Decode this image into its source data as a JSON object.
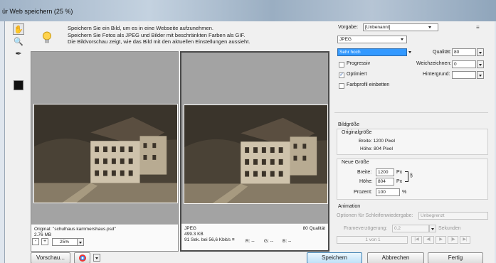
{
  "window": {
    "title": "ür Web speichern (25 %)"
  },
  "info": {
    "line1": "Speichern Sie ein Bild, um es in eine Webseite aufzunehmen.",
    "line2": "Speichern Sie Fotos als JPEG und Bilder mit beschränkten Farben als GIF.",
    "line3": "Die Bildvorschau zeigt, wie das Bild mit den aktuellen Einstellungen aussieht."
  },
  "left_pane": {
    "name": "Original: \"schulhaus kammershaus.psd\"",
    "size": "2.76 MB"
  },
  "right_pane": {
    "format": "JPEG",
    "size": "499.3 KB",
    "time": "91 Sek. bei 56,6 Kbit/s",
    "time_icon": "≡",
    "quality": "80 Qualität"
  },
  "bottom": {
    "zoom": "25%",
    "r": "R: --",
    "g": "G: --",
    "b": "B: --",
    "preview": "Vorschau...",
    "save": "Speichern",
    "cancel": "Abbrechen",
    "done": "Fertig",
    "zoom_minus": "-",
    "zoom_plus": "+"
  },
  "settings": {
    "preset_label": "Vorgabe:",
    "preset_value": "[Unbenannt]",
    "format": "JPEG",
    "quality_preset": "Sehr hoch",
    "quality_label": "Qualität:",
    "quality_value": "80",
    "progressive": "Progressiv",
    "blur_label": "Weichzeichnen:",
    "blur_value": "0",
    "optimized": "Optimiert",
    "background_label": "Hintergrund:",
    "embed_profile": "Farbprofil einbetten",
    "checkmark": "✓"
  },
  "image_size": {
    "header": "Bildgröße",
    "original_header": "Originalgröße",
    "orig_width": "Breite:  1200 Pixel",
    "orig_height": "Höhe:  804 Pixel",
    "new_header": "Neue Größe",
    "width_label": "Breite:",
    "width_value": "1200",
    "height_label": "Höhe:",
    "height_value": "804",
    "unit": "Px",
    "percent_label": "Prozent:",
    "percent_value": "100",
    "percent_unit": "%"
  },
  "animation": {
    "header": "Animation",
    "loop_label": "Optionen für Schleifenwiedergabe:",
    "loop_value": "Unbegrenzt",
    "delay_label": "Frameverzögerung:",
    "delay_value": "0.2",
    "delay_unit": "Sekunden",
    "frame_count": "1 von 1"
  },
  "colors": {
    "accent": "#3399ff",
    "bg": "#f0f0f0",
    "pane": "#a3a3a3"
  }
}
